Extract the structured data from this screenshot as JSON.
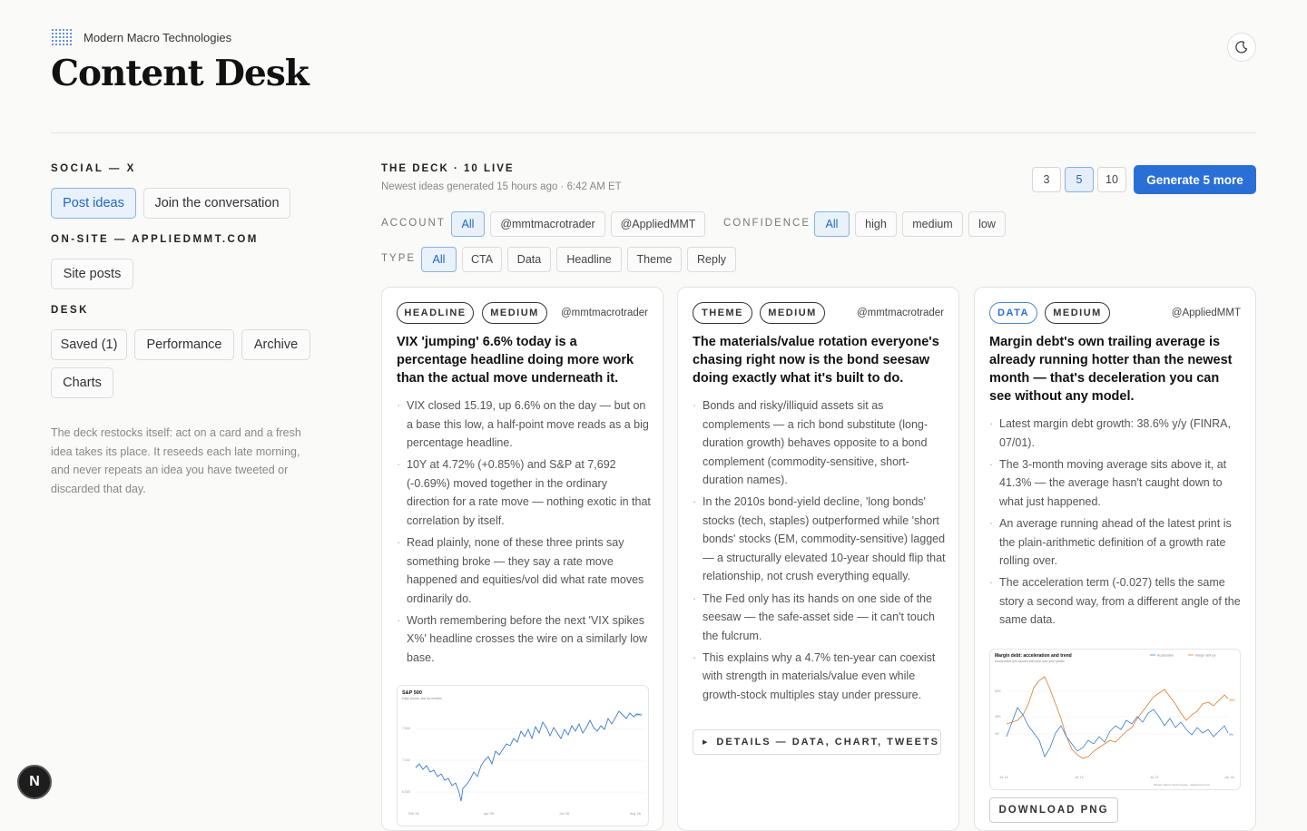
{
  "brand": {
    "name": "Modern Macro Technologies"
  },
  "page_title": "Content Desk",
  "sidebar": {
    "social_label": "SOCIAL — X",
    "post_ideas": "Post ideas",
    "join": "Join the conversation",
    "onsite_label": "ON-SITE — APPLIEDMMT.COM",
    "site_posts": "Site posts",
    "desk_label": "DESK",
    "saved": "Saved (1)",
    "performance": "Performance",
    "archive": "Archive",
    "charts": "Charts",
    "description": "The deck restocks itself: act on a card and a fresh idea takes its place. It reseeds each late morning, and never repeats an idea you have tweeted or discarded that day."
  },
  "deck": {
    "title": "THE DECK · 10 LIVE",
    "subtitle": "Newest ideas generated 15 hours ago · 6:42 AM ET",
    "counts": [
      "3",
      "5",
      "10"
    ],
    "selected_count": "5",
    "generate_label": "Generate 5 more"
  },
  "filters": {
    "account_label": "ACCOUNT",
    "accounts": [
      "All",
      "@mmtmacrotrader",
      "@AppliedMMT"
    ],
    "confidence_label": "CONFIDENCE",
    "confidence": [
      "All",
      "high",
      "medium",
      "low"
    ],
    "type_label": "TYPE",
    "types": [
      "All",
      "CTA",
      "Data",
      "Headline",
      "Theme",
      "Reply"
    ]
  },
  "cards": [
    {
      "type": "HEADLINE",
      "confidence": "MEDIUM",
      "handle": "@mmtmacrotrader",
      "title": "VIX 'jumping' 6.6% today is a percentage headline doing more work than the actual move underneath it.",
      "bullets": [
        "VIX closed 15.19, up 6.6% on the day — but on a base this low, a half-point move reads as a big percentage headline.",
        "10Y at 4.72% (+0.85%) and S&P at 7,692 (-0.69%) moved together in the ordinary direction for a rate move — nothing exotic in that correlation by itself.",
        "Read plainly, none of these three prints say something broke — they say a rate move happened and equities/vol did what rate moves ordinarily do.",
        "Worth remembering before the next 'VIX spikes X%' headline crosses the wire on a similarly low base."
      ],
      "chart": {
        "title": "S&P 500",
        "subtitle": "Daily closes, last six months",
        "y_ticks": [
          "7,500",
          "7,000",
          "6,500"
        ],
        "x_ticks": [
          "Feb '26",
          "Apr '26",
          "Jun '26",
          "Aug '26"
        ],
        "end_label": "7,692"
      }
    },
    {
      "type": "THEME",
      "confidence": "MEDIUM",
      "handle": "@mmtmacrotrader",
      "title": "The materials/value rotation everyone's chasing right now is the bond seesaw doing exactly what it's built to do.",
      "bullets": [
        "Bonds and risky/illiquid assets sit as complements — a rich bond substitute (long-duration growth) behaves opposite to a bond complement (commodity-sensitive, short-duration names).",
        "In the 2010s bond-yield decline, 'long bonds' stocks (tech, staples) outperformed while 'short bonds' stocks (EM, commodity-sensitive) lagged — a structurally elevated 10-year should flip that relationship, not crush everything equally.",
        "The Fed only has its hands on one side of the seesaw — the safe-asset side — it can't touch the fulcrum.",
        "This explains why a 4.7% ten-year can coexist with strength in materials/value even while growth-stock multiples stay under pressure."
      ],
      "details_label": "DETAILS — DATA, CHART, TWEETS"
    },
    {
      "type": "DATA",
      "confidence": "MEDIUM",
      "handle": "@AppliedMMT",
      "title": "Margin debt's own trailing average is already running hotter than the newest month — that's deceleration you can see without any model.",
      "bullets": [
        "Latest margin debt growth: 38.6% y/y (FINRA, 07/01).",
        "The 3-month moving average sits above it, at 41.3% — the average hasn't caught down to what just happened.",
        "An average running ahead of the latest print is the plain-arithmetic definition of a growth rate rolling over.",
        "The acceleration term (-0.027) tells the same story a second way, from a different angle of the same data."
      ],
      "chart": {
        "title": "Margin debt: acceleration and trend",
        "subtitle": "Acceleration (the square) with year-over-year growth",
        "legend": [
          "Acceleration",
          "Margin debt y/y"
        ],
        "y_ticks": [
          "80%",
          "40%",
          "0%"
        ],
        "x_ticks": [
          "Jul '16",
          "Jul '19",
          "Jul '22",
          "Jun '26"
        ],
        "end_labels": [
          "39%",
          "0%"
        ],
        "footer": "Modern Macro Technologies · appliedmmt.com"
      },
      "download_label": "DOWNLOAD PNG"
    }
  ],
  "colors": {
    "accent": "#2a6fd6",
    "orange": "#e07b2a",
    "blue_series": "#3a7bd5"
  },
  "icons": {
    "theme": "moon-icon",
    "brand": "dot-grid-logo",
    "badge": "N"
  }
}
